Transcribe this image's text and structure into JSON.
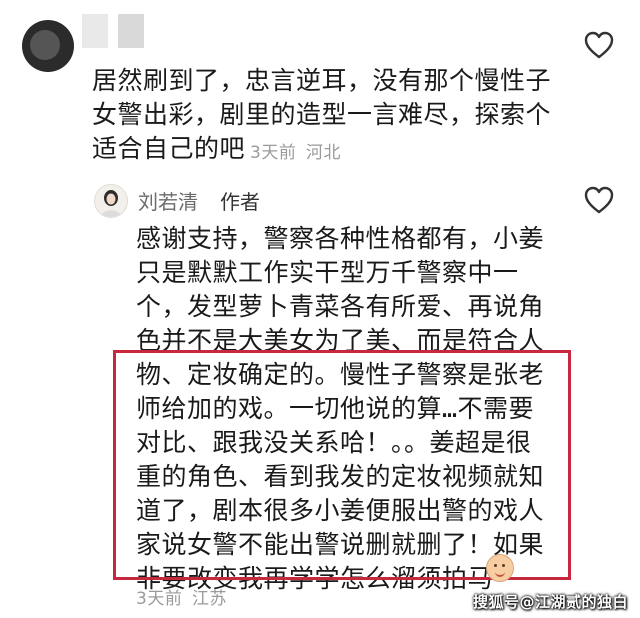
{
  "comment1": {
    "text": "居然刷到了，忠言逆耳，没有那个慢性子\n女警出彩，剧里的造型一言难尽，探索个\n适合自己的吧",
    "time": "3天前",
    "location": "河北"
  },
  "reply": {
    "author_name": "刘若清",
    "author_tag": "作者",
    "text_top": "感谢支持，警察各种性格都有，小姜\n只是默默工作实干型万千警察中一\n个，发型萝卜青菜各有所爱、再说角\n色并不是大美女为了美、而是符合人",
    "text_highlight": "物、定妆确定的。慢性子警察是张老\n师给加的戏。一切他说的算…不需要\n对比、跟我没关系哈！。。姜超是很\n重的角色、看到我发的定妆视频就知\n道了，剧本很多小姜便服出警的戏人\n家说女警不能出警说删就删了！如果\n非要改变我再学学怎么溜须拍马",
    "time": "3天前",
    "location": "江苏"
  },
  "watermark": "搜狐号@江湖贰的独白",
  "icons": {
    "like": "heart-outline-icon",
    "emoji": "smiling-face-emoji"
  },
  "colors": {
    "highlight_border": "#c8283d",
    "meta_gray": "#9a9a9a"
  }
}
